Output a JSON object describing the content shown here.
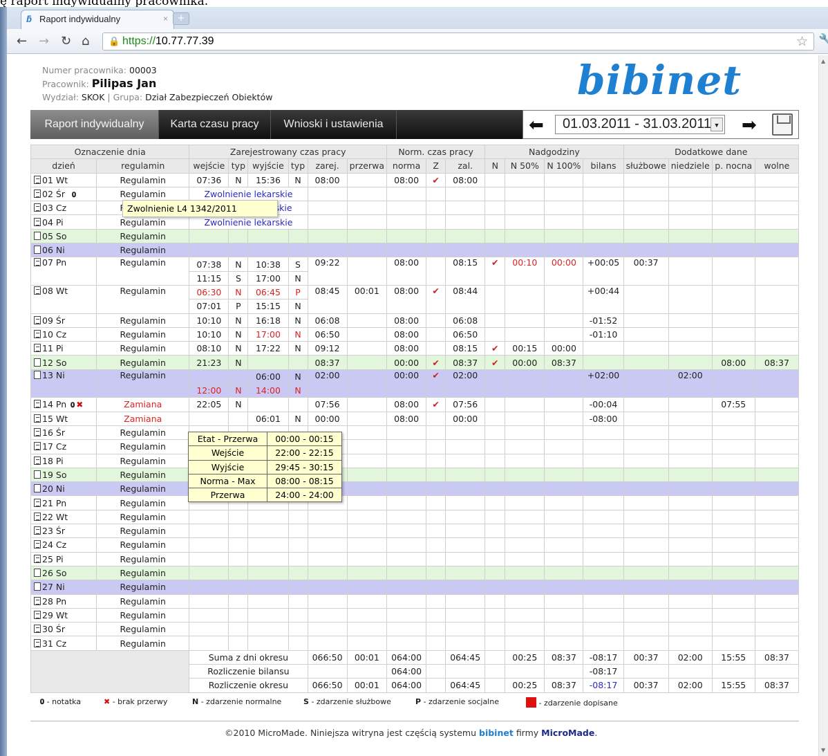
{
  "caption": "ę raport indywidualny pracownika.",
  "browser": {
    "tab_title": "Raport indywidualny",
    "url_scheme": "https://",
    "url_host": "10.77.77.39"
  },
  "employee": {
    "number_label": "Numer pracownika:",
    "number": "00003",
    "name_label": "Pracownik:",
    "name": "Pilipas Jan",
    "dept_label": "Wydział:",
    "dept": "SKOK",
    "group_label": "Grupa:",
    "group": "Dział Zabezpieczeń Obiektów"
  },
  "logo": "bibinet",
  "menu": {
    "items": [
      "Raport indywidualny",
      "Karta czasu pracy",
      "Wnioski i ustawienia"
    ],
    "date_range": "01.03.2011 - 31.03.2011"
  },
  "table": {
    "group_headers": [
      "Oznaczenie dnia",
      "Zarejestrowany czas pracy",
      "Norm. czas pracy",
      "Nadgodziny",
      "Dodatkowe dane"
    ],
    "columns": [
      "dzień",
      "regulamin",
      "wejście",
      "typ",
      "wyjście",
      "typ",
      "zarej.",
      "przerwa",
      "norma",
      "Z",
      "zal.",
      "N",
      "N 50%",
      "N 100%",
      "bilans",
      "służbowe",
      "niedziele",
      "p. nocna",
      "wolne"
    ],
    "day_labels": [
      "01 Wt",
      "02 Śr",
      "03 Cz",
      "04 Pi",
      "05 So",
      "06 Ni",
      "07 Pn",
      "08 Wt",
      "09 Śr",
      "10 Cz",
      "11 Pi",
      "12 So",
      "13 Ni",
      "14 Pn",
      "15 Wt",
      "16 Śr",
      "17 Cz",
      "18 Pi",
      "19 So",
      "20 Ni",
      "21 Pn",
      "22 Wt",
      "23 Śr",
      "24 Cz",
      "25 Pi",
      "26 So",
      "27 Ni",
      "28 Pn",
      "29 Wt",
      "30 Śr",
      "31 Cz"
    ],
    "reg": "Regulamin",
    "zamiana": "Zamiana",
    "zwolnienie": "Zwolnienie lekarskie",
    "zwolnienie_part": "skie",
    "check": "✔",
    "r01": [
      "07:36",
      "N",
      "15:36",
      "N",
      "08:00",
      "",
      "08:00",
      "✔",
      "08:00"
    ],
    "r07a": [
      "07:38",
      "N",
      "10:38",
      "S",
      "09:22",
      "",
      "08:00",
      "",
      "08:15",
      "✔",
      "00:10",
      "00:00",
      "+00:05",
      "00:37"
    ],
    "r07b": [
      "11:15",
      "S",
      "17:00",
      "N"
    ],
    "r08a": [
      "06:30",
      "N",
      "06:45",
      "P",
      "08:45",
      "00:01",
      "08:00",
      "✔",
      "08:44",
      "+00:44"
    ],
    "r08b": [
      "07:01",
      "P",
      "15:15",
      "N"
    ],
    "r09": [
      "10:10",
      "N",
      "16:18",
      "N",
      "06:08",
      "08:00",
      "06:08",
      "-01:52"
    ],
    "r10": [
      "10:10",
      "N",
      "17:00",
      "N",
      "06:50",
      "08:00",
      "06:50",
      "-01:10"
    ],
    "r11": [
      "08:10",
      "N",
      "17:22",
      "N",
      "09:12",
      "08:00",
      "08:15",
      "✔",
      "00:15",
      "00:00"
    ],
    "r12": [
      "21:23",
      "N",
      "08:37",
      "00:00",
      "✔",
      "08:37",
      "✔",
      "00:00",
      "08:37",
      "08:00",
      "08:37"
    ],
    "r13a": [
      "06:00",
      "N",
      "02:00",
      "00:00",
      "✔",
      "02:00",
      "+02:00",
      "02:00"
    ],
    "r13b": [
      "12:00",
      "N",
      "14:00",
      "N"
    ],
    "r14": [
      "22:05",
      "N",
      "07:56",
      "08:00",
      "✔",
      "07:56",
      "-00:04",
      "07:55"
    ],
    "r15": [
      "06:01",
      "N",
      "00:00",
      "08:00",
      "00:00",
      "-08:00"
    ],
    "sum_labels": [
      "Suma z dni okresu",
      "Rozliczenie bilansu",
      "Rozliczenie okresu"
    ],
    "sum1": [
      "066:50",
      "00:01",
      "064:00",
      "064:45",
      "00:25",
      "08:37",
      "-08:17",
      "00:37",
      "02:00",
      "15:55",
      "08:37"
    ],
    "sum2": [
      "064:00",
      "-08:17"
    ],
    "sum3": [
      "066:50",
      "00:01",
      "064:00",
      "064:45",
      "00:25",
      "08:37",
      "-08:17",
      "00:37",
      "02:00",
      "15:55",
      "08:37"
    ]
  },
  "tooltip1": "Zwolnienie L4 1342/2011",
  "tooltip2": [
    [
      "Etat - Przerwa",
      "00:00 - 00:15"
    ],
    [
      "Wejście",
      "22:00 - 22:15"
    ],
    [
      "Wyjście",
      "29:45 - 30:15"
    ],
    [
      "Norma - Max",
      "08:00 - 08:15"
    ],
    [
      "Przerwa",
      "24:00 - 24:00"
    ]
  ],
  "legend": {
    "note": "- notatka",
    "break": "- brak przerwy",
    "n_key": "N",
    "n": "- zdarzenie normalne",
    "s_key": "S",
    "s": "- zdarzenie służbowe",
    "p_key": "P",
    "p": "- zdarzenie socjalne",
    "added": "- zdarzenie dopisane"
  },
  "footer": {
    "pre": "©2010 MicroMade. Niniejsza witryna jest częścią systemu",
    "brand": "bibinet",
    "mid": "firmy",
    "company": "MicroMade",
    "end": "."
  },
  "colors": {
    "sat": "#e2f6dc",
    "sun": "#c9c9f4",
    "accent": "#1f7fd0",
    "red": "#d22222"
  }
}
